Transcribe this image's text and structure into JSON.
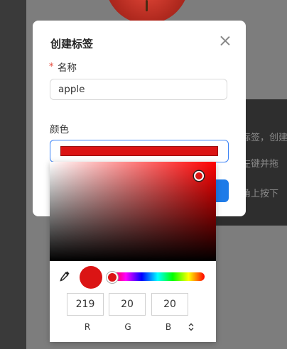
{
  "dialog": {
    "title": "创建标签",
    "name_label": "名称",
    "required_mark": "*",
    "name_value": "apple",
    "color_label": "颜色"
  },
  "background": {
    "lines": [
      "标签，创建",
      "左键并拖",
      "角上按下"
    ]
  },
  "color_picker": {
    "hex": "#DB1414",
    "channels": [
      {
        "label": "R",
        "value": "219"
      },
      {
        "label": "G",
        "value": "20"
      },
      {
        "label": "B",
        "value": "20"
      }
    ],
    "mode_toggle_icon": "up-down-arrows-icon"
  }
}
